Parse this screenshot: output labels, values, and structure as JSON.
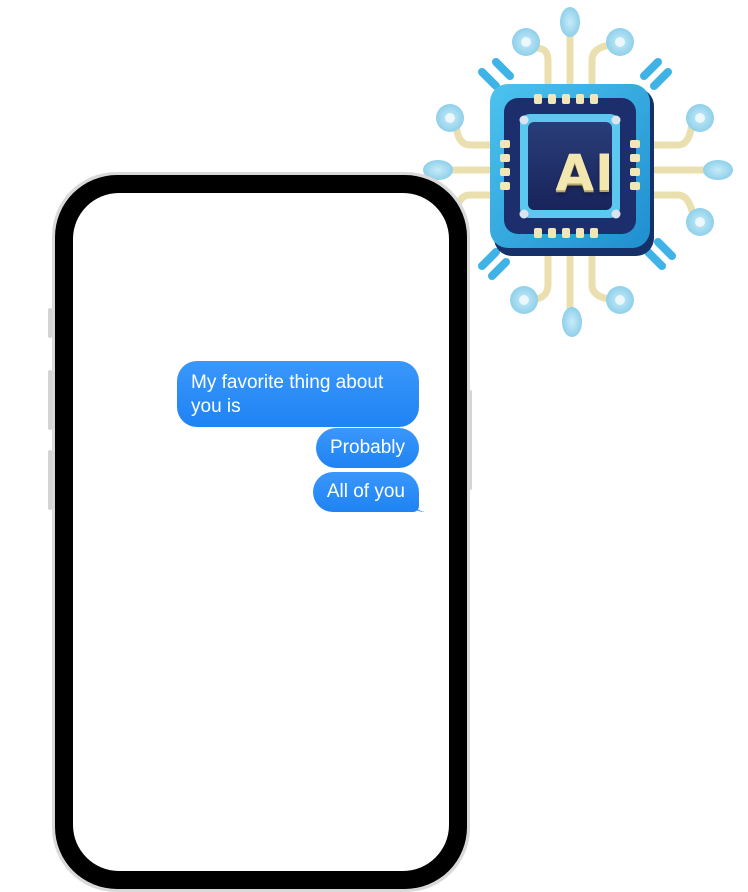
{
  "illustration": {
    "icon": "ai-chip-icon",
    "label": "AI",
    "colors": {
      "chip_outer": "#2aa3dc",
      "chip_inner": "#1c2b5e",
      "pins": "#f1e6b8",
      "circuit_nodes": "#9ed4ea"
    }
  },
  "conversation": {
    "bubble_color": "#1f83f3",
    "messages": [
      {
        "text": "My favorite thing about you is",
        "sender": "me"
      },
      {
        "text": "Probably",
        "sender": "me"
      },
      {
        "text": "All of you",
        "sender": "me"
      }
    ]
  }
}
